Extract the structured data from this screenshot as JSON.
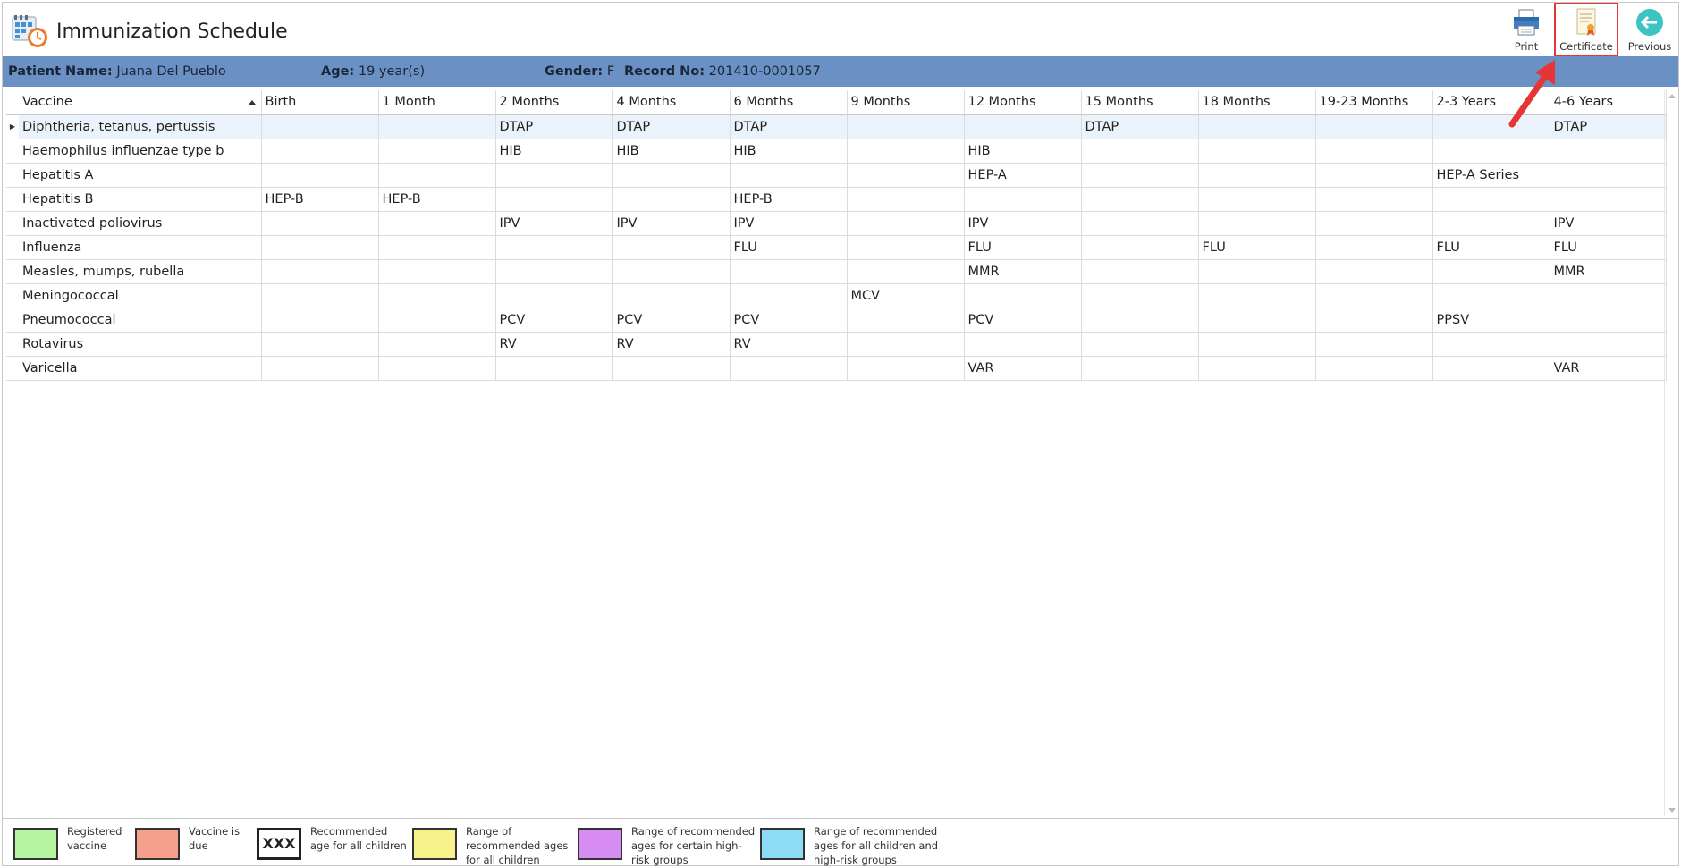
{
  "app": {
    "title": "Immunization Schedule",
    "toolbar": {
      "print_label": "Print",
      "certificate_label": "Certificate",
      "previous_label": "Previous"
    }
  },
  "patient": {
    "name_label": "Patient Name:",
    "name": "Juana Del Pueblo",
    "age_label": "Age:",
    "age": "19 year(s)",
    "gender_label": "Gender:",
    "gender": "F",
    "record_label": "Record No:",
    "record": "201410-0001057"
  },
  "grid": {
    "columns": [
      "Vaccine",
      "Birth",
      "1 Month",
      "2 Months",
      "4 Months",
      "6 Months",
      "9 Months",
      "12 Months",
      "15 Months",
      "18 Months",
      "19-23 Months",
      "2-3 Years",
      "4-6 Years"
    ],
    "rows": [
      [
        "Diphtheria, tetanus, pertussis",
        "",
        "",
        "DTAP",
        "DTAP",
        "DTAP",
        "",
        "",
        "DTAP",
        "",
        "",
        "",
        "DTAP"
      ],
      [
        "Haemophilus influenzae type b",
        "",
        "",
        "HIB",
        "HIB",
        "HIB",
        "",
        "HIB",
        "",
        "",
        "",
        "",
        ""
      ],
      [
        "Hepatitis A",
        "",
        "",
        "",
        "",
        "",
        "",
        "HEP-A",
        "",
        "",
        "",
        "HEP-A Series",
        ""
      ],
      [
        "Hepatitis B",
        "HEP-B",
        "HEP-B",
        "",
        "",
        "HEP-B",
        "",
        "",
        "",
        "",
        "",
        "",
        ""
      ],
      [
        "Inactivated poliovirus",
        "",
        "",
        "IPV",
        "IPV",
        "IPV",
        "",
        "IPV",
        "",
        "",
        "",
        "",
        "IPV"
      ],
      [
        "Influenza",
        "",
        "",
        "",
        "",
        "FLU",
        "",
        "FLU",
        "",
        "FLU",
        "",
        "FLU",
        "FLU"
      ],
      [
        "Measles, mumps, rubella",
        "",
        "",
        "",
        "",
        "",
        "",
        "MMR",
        "",
        "",
        "",
        "",
        "MMR"
      ],
      [
        "Meningococcal",
        "",
        "",
        "",
        "",
        "",
        "MCV",
        "",
        "",
        "",
        "",
        "",
        ""
      ],
      [
        "Pneumococcal",
        "",
        "",
        "PCV",
        "PCV",
        "PCV",
        "",
        "PCV",
        "",
        "",
        "",
        "PPSV",
        ""
      ],
      [
        "Rotavirus",
        "",
        "",
        "RV",
        "RV",
        "RV",
        "",
        "",
        "",
        "",
        "",
        "",
        ""
      ],
      [
        "Varicella",
        "",
        "",
        "",
        "",
        "",
        "",
        "VAR",
        "",
        "",
        "",
        "",
        "VAR"
      ]
    ]
  },
  "legend": {
    "items": [
      {
        "color": "#b5f5a0",
        "label1": "Registered",
        "label2": "vaccine",
        "label3": ""
      },
      {
        "color": "#f5a08c",
        "label1": "Vaccine is",
        "label2": "due",
        "label3": ""
      },
      {
        "color": "#ffffff",
        "text": "XXX",
        "label1": "Recommended",
        "label2": "age for all children",
        "label3": ""
      },
      {
        "color": "#f7f28c",
        "label1": "Range of",
        "label2": "recommended ages",
        "label3": "for all children"
      },
      {
        "color": "#d68cf2",
        "label1": "Range of recommended",
        "label2": "ages for certain high-",
        "label3": "risk groups"
      },
      {
        "color": "#8cdcf5",
        "label1": "Range of recommended",
        "label2": "ages for all children and",
        "label3": "high-risk groups"
      }
    ]
  },
  "colors": {
    "patient_bar": "#6a90c4",
    "highlight": "#e53535",
    "selected_row": "#eaf3fb"
  }
}
